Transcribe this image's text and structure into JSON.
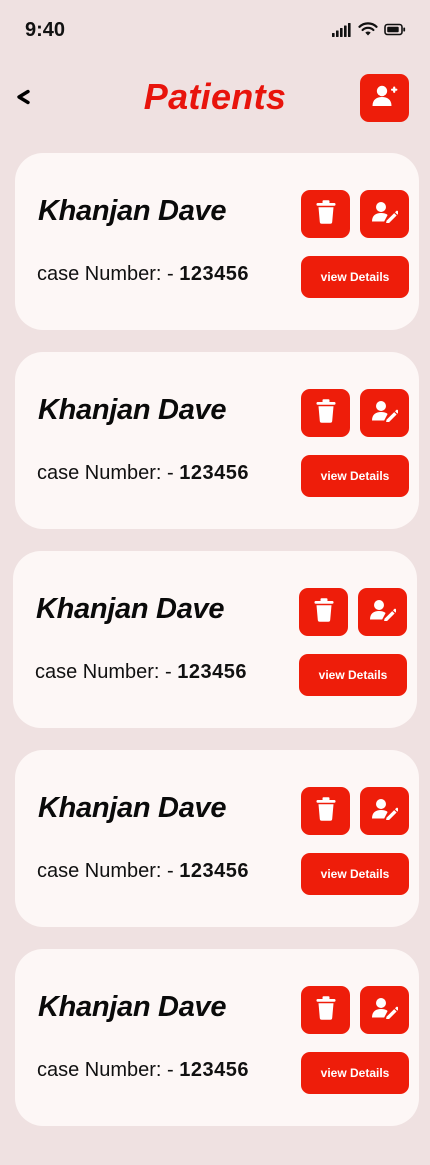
{
  "status_bar": {
    "time": "9:40",
    "icons": [
      "cellular-signal-icon",
      "wifi-icon",
      "battery-icon"
    ]
  },
  "header": {
    "title": "Patients",
    "back_icon": "chevron-left-icon",
    "add_icon": "user-plus-icon"
  },
  "patients": [
    {
      "name": "Khanjan Dave",
      "case_label": "case Number: - ",
      "case_number": "123456",
      "details_label": "view Details"
    },
    {
      "name": "Khanjan Dave",
      "case_label": "case Number: - ",
      "case_number": "123456",
      "details_label": "view Details"
    },
    {
      "name": "Khanjan Dave",
      "case_label": "case Number: - ",
      "case_number": "123456",
      "details_label": "view Details"
    },
    {
      "name": "Khanjan Dave",
      "case_label": "case Number: - ",
      "case_number": "123456",
      "details_label": "view Details"
    },
    {
      "name": "Khanjan Dave",
      "case_label": "case Number: - ",
      "case_number": "123456",
      "details_label": "view Details"
    }
  ],
  "card_icons": {
    "delete": "trash-icon",
    "edit": "user-edit-icon"
  },
  "colors": {
    "background": "#efe1e1",
    "card": "#fdf7f6",
    "accent": "#ee1d0a",
    "title": "#e8140c"
  }
}
